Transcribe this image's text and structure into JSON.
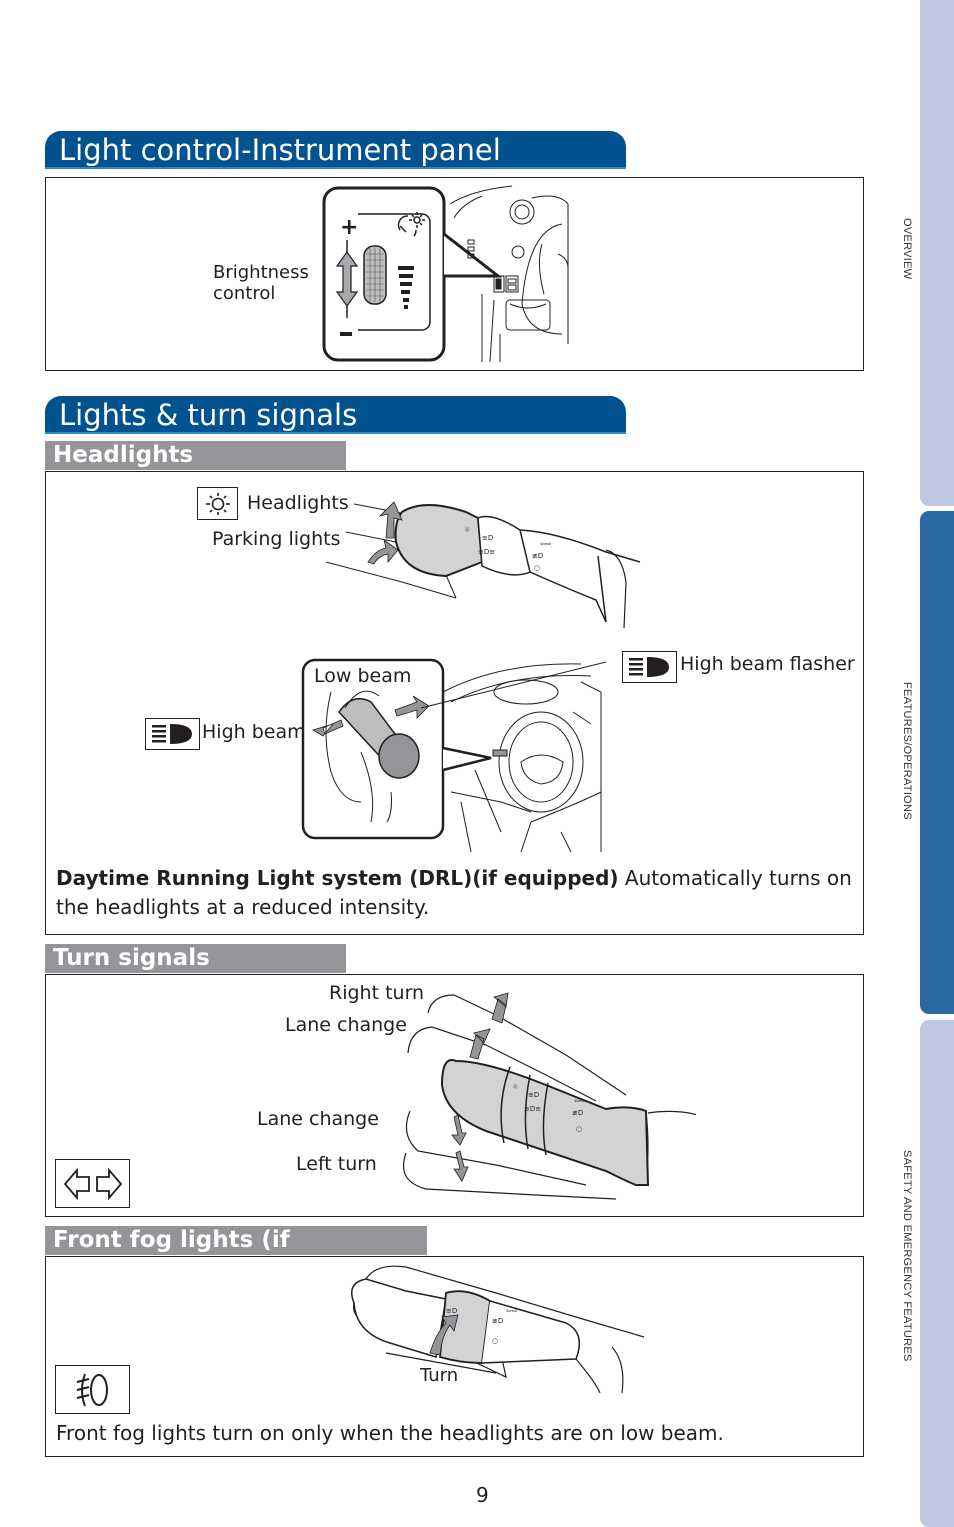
{
  "side_tabs": [
    {
      "label": "OVERVIEW",
      "active": false
    },
    {
      "label": "FEATURES/OPERATIONS",
      "active": true
    },
    {
      "label": "SAFETY AND EMERGENCY FEATURES",
      "active": false
    }
  ],
  "colors": {
    "heading_blue": "#01528f",
    "subheading_gray": "#939598",
    "tab_active": "#2b68a6",
    "tab_inactive": "#bfc8e1"
  },
  "section_light_control": {
    "title": "Light control-Instrument panel",
    "brightness_label_line1": "Brightness",
    "brightness_label_line2": "control",
    "plus_symbol": "+",
    "minus_symbol": "-"
  },
  "section_lights": {
    "title": "Lights & turn signals",
    "headlights": {
      "heading": "Headlights",
      "labels": {
        "headlights": "Headlights",
        "parking_lights": "Parking lights",
        "low_beam": "Low beam",
        "high_beam": "High beam",
        "high_beam_flasher": "High beam flasher"
      },
      "icons": [
        "headlight-icon",
        "high-beam-icon",
        "high-beam-flasher-icon"
      ],
      "drl_bold": "Daytime Running Light system (DRL)(if equipped)",
      "drl_text": " Automatically turns on the headlights at a reduced intensity."
    },
    "turn_signals": {
      "heading": "Turn signals",
      "labels": {
        "right_turn": "Right turn",
        "lane_change_up": "Lane change",
        "lane_change_down": "Lane change",
        "left_turn": "Left turn"
      },
      "icon": "turn-signal-arrows-icon"
    },
    "fog_lights": {
      "heading": "Front fog lights (if equipped)",
      "turn_label": "Turn",
      "icon": "fog-light-icon",
      "note": "Front fog lights turn on only when the headlights are on low beam."
    }
  },
  "page_number": "9"
}
